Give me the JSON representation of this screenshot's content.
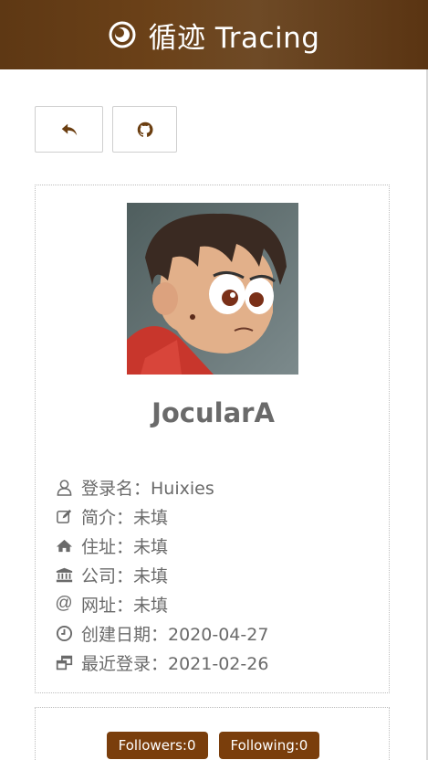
{
  "header": {
    "title": "循迹 Tracing",
    "logo_icon": "circle-target-icon"
  },
  "toolbar": {
    "back_icon": "reply-arrow-icon",
    "github_icon": "github-icon"
  },
  "profile": {
    "display_name": "JocularA",
    "avatar_alt": "avatar",
    "info": [
      {
        "icon": "user-icon",
        "text": "登录名：Huixies"
      },
      {
        "icon": "edit-icon",
        "text": "简介：未填"
      },
      {
        "icon": "home-icon",
        "text": "住址：未填"
      },
      {
        "icon": "bank-icon",
        "text": "公司：未填"
      },
      {
        "icon": "at-icon",
        "text": "网址：未填"
      },
      {
        "icon": "clock-icon",
        "text": "创建日期：2020-04-27"
      },
      {
        "icon": "window-restore-icon",
        "text": "最近登录：2021-02-26"
      }
    ]
  },
  "follow": {
    "followers": "Followers:0",
    "following": "Following:0"
  },
  "colors": {
    "header": "#6b4118",
    "accent": "#7a3e0c",
    "text": "#6a6a6a"
  }
}
